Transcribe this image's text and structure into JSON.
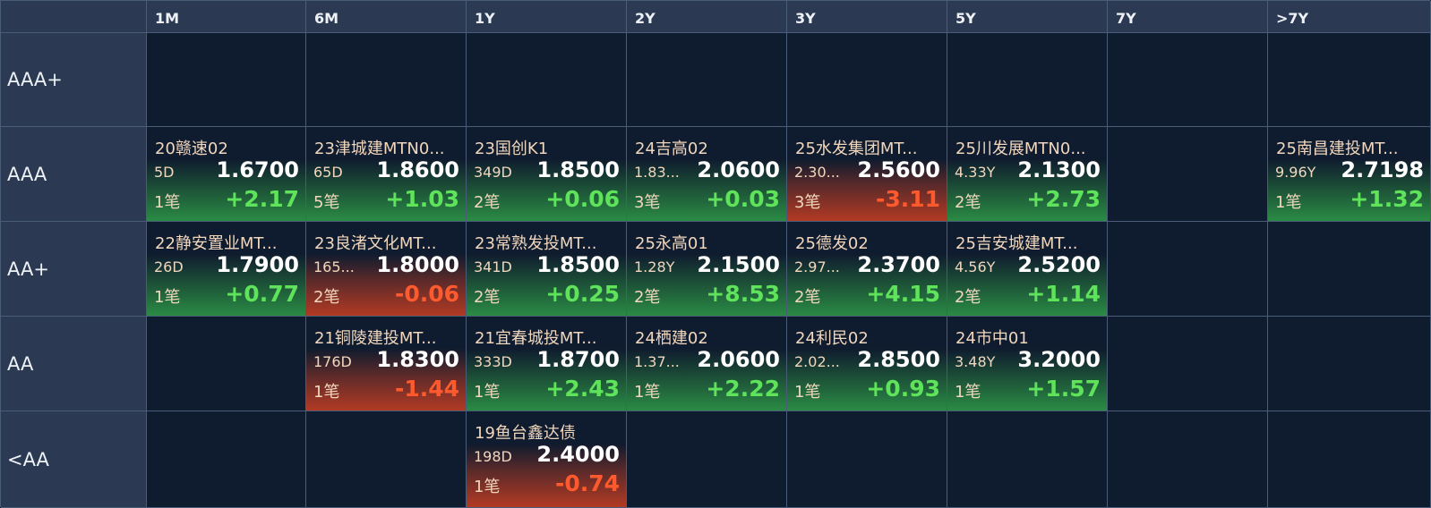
{
  "columns": [
    "1M",
    "6M",
    "1Y",
    "2Y",
    "3Y",
    "5Y",
    "7Y",
    ">7Y"
  ],
  "rows": [
    {
      "rating": "AAA+",
      "cells": [
        null,
        null,
        null,
        null,
        null,
        null,
        null,
        null
      ]
    },
    {
      "rating": "AAA",
      "cells": [
        {
          "name": "20赣速02",
          "term": "5D",
          "price": "1.6700",
          "count": "1笔",
          "change": "+2.17",
          "dir": "up"
        },
        {
          "name": "23津城建MTN0...",
          "term": "65D",
          "price": "1.8600",
          "count": "5笔",
          "change": "+1.03",
          "dir": "up"
        },
        {
          "name": "23国创K1",
          "term": "349D",
          "price": "1.8500",
          "count": "2笔",
          "change": "+0.06",
          "dir": "up"
        },
        {
          "name": "24吉高02",
          "term": "1.83...",
          "price": "2.0600",
          "count": "3笔",
          "change": "+0.03",
          "dir": "up"
        },
        {
          "name": "25水发集团MT...",
          "term": "2.30...",
          "price": "2.5600",
          "count": "3笔",
          "change": "-3.11",
          "dir": "down"
        },
        {
          "name": "25川发展MTN0...",
          "term": "4.33Y",
          "price": "2.1300",
          "count": "2笔",
          "change": "+2.73",
          "dir": "up"
        },
        null,
        {
          "name": "25南昌建投MT...",
          "term": "9.96Y",
          "price": "2.7198",
          "count": "1笔",
          "change": "+1.32",
          "dir": "up"
        }
      ]
    },
    {
      "rating": "AA+",
      "cells": [
        {
          "name": "22静安置业MT...",
          "term": "26D",
          "price": "1.7900",
          "count": "1笔",
          "change": "+0.77",
          "dir": "up"
        },
        {
          "name": "23良渚文化MT...",
          "term": "165...",
          "price": "1.8000",
          "count": "2笔",
          "change": "-0.06",
          "dir": "down"
        },
        {
          "name": "23常熟发投MT...",
          "term": "341D",
          "price": "1.8500",
          "count": "2笔",
          "change": "+0.25",
          "dir": "up"
        },
        {
          "name": "25永高01",
          "term": "1.28Y",
          "price": "2.1500",
          "count": "2笔",
          "change": "+8.53",
          "dir": "up"
        },
        {
          "name": "25德发02",
          "term": "2.97...",
          "price": "2.3700",
          "count": "2笔",
          "change": "+4.15",
          "dir": "up"
        },
        {
          "name": "25吉安城建MT...",
          "term": "4.56Y",
          "price": "2.5200",
          "count": "2笔",
          "change": "+1.14",
          "dir": "up"
        },
        null,
        null
      ]
    },
    {
      "rating": "AA",
      "cells": [
        null,
        {
          "name": "21铜陵建投MT...",
          "term": "176D",
          "price": "1.8300",
          "count": "1笔",
          "change": "-1.44",
          "dir": "down"
        },
        {
          "name": "21宜春城投MT...",
          "term": "333D",
          "price": "1.8700",
          "count": "1笔",
          "change": "+2.43",
          "dir": "up"
        },
        {
          "name": "24栖建02",
          "term": "1.37...",
          "price": "2.0600",
          "count": "1笔",
          "change": "+2.22",
          "dir": "up"
        },
        {
          "name": "24利民02",
          "term": "2.02...",
          "price": "2.8500",
          "count": "1笔",
          "change": "+0.93",
          "dir": "up"
        },
        {
          "name": "24市中01",
          "term": "3.48Y",
          "price": "3.2000",
          "count": "1笔",
          "change": "+1.57",
          "dir": "up"
        },
        null,
        null
      ]
    },
    {
      "rating": "<AA",
      "cells": [
        null,
        null,
        {
          "name": "19鱼台鑫达债",
          "term": "198D",
          "price": "2.4000",
          "count": "1笔",
          "change": "-0.74",
          "dir": "down"
        },
        null,
        null,
        null,
        null,
        null
      ]
    }
  ],
  "colors": {
    "background": "#0f1b2e",
    "header": "#2b3a52",
    "up": "#5fe35a",
    "down": "#ff5a2d",
    "label": "#f1d7bd"
  }
}
